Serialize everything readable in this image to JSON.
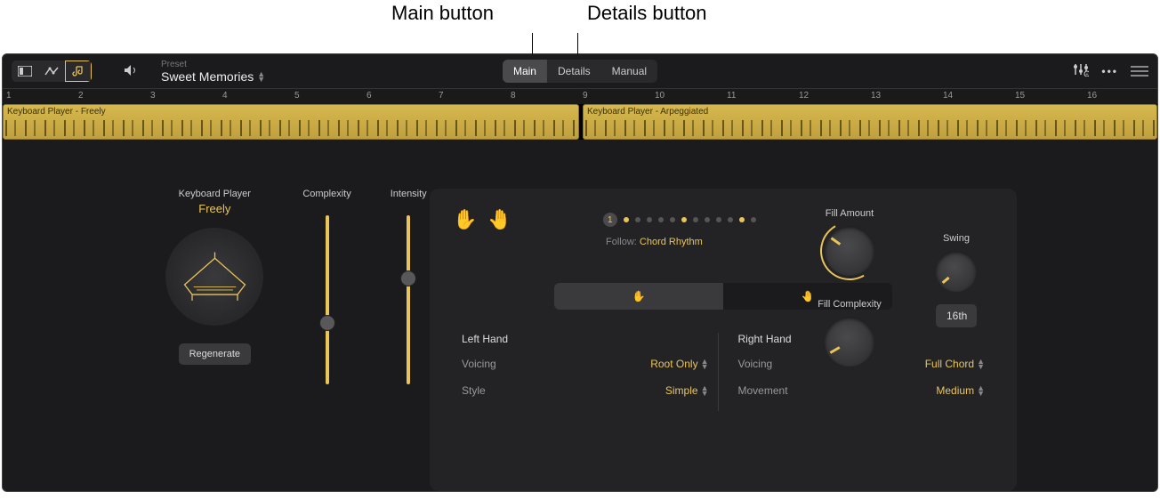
{
  "callouts": {
    "main": "Main button",
    "details": "Details button"
  },
  "toolbar": {
    "preset_label": "Preset",
    "preset_name": "Sweet Memories"
  },
  "modes": {
    "main": "Main",
    "details": "Details",
    "manual": "Manual"
  },
  "ruler": {
    "labels": [
      "1",
      "2",
      "3",
      "4",
      "5",
      "6",
      "7",
      "8",
      "9",
      "10",
      "11",
      "12",
      "13",
      "14",
      "15",
      "16"
    ]
  },
  "regions": {
    "a": "Keyboard Player - Freely",
    "b": "Keyboard Player - Arpeggiated"
  },
  "player": {
    "label": "Keyboard Player",
    "name": "Freely",
    "regenerate": "Regenerate"
  },
  "sliders": {
    "complexity_label": "Complexity",
    "intensity_label": "Intensity"
  },
  "follow": {
    "label": "Follow:",
    "value": "Chord Rhythm",
    "step": "1"
  },
  "hands": {
    "left_title": "Left Hand",
    "right_title": "Right Hand",
    "voicing_label": "Voicing",
    "style_label": "Style",
    "movement_label": "Movement",
    "left_voicing": "Root Only",
    "left_style": "Simple",
    "right_voicing": "Full Chord",
    "right_movement": "Medium"
  },
  "knobs": {
    "fill_amount": "Fill Amount",
    "fill_complexity": "Fill Complexity",
    "swing": "Swing",
    "swing_value": "16th"
  }
}
